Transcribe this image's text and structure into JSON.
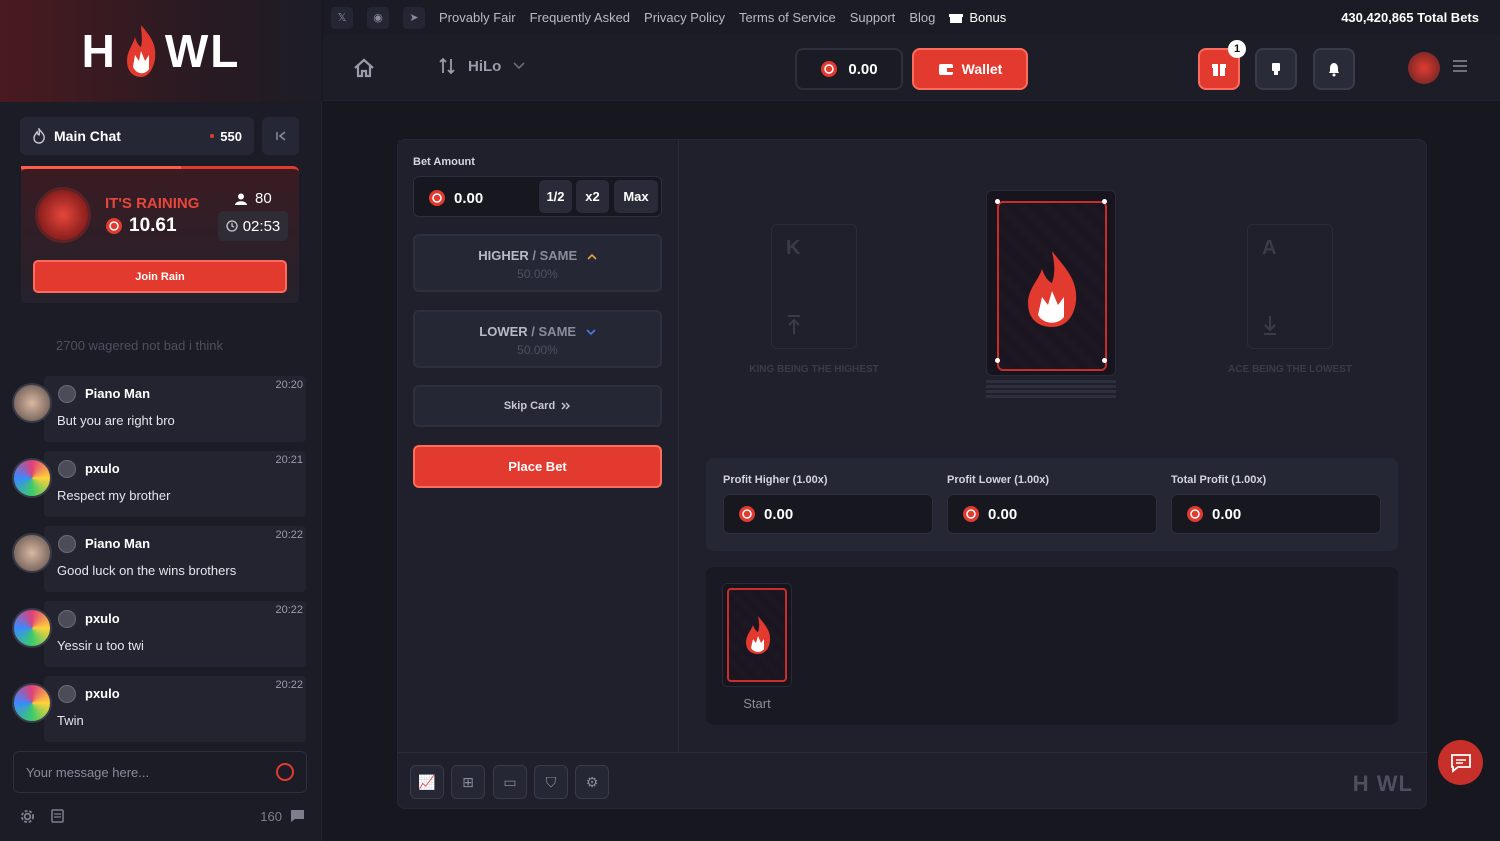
{
  "brand": {
    "logo_left": "H",
    "logo_right": "WL",
    "footer_logo": "H WL"
  },
  "top_nav": {
    "social": [
      "x-icon",
      "discord-icon",
      "telegram-icon"
    ],
    "links": [
      "Provably Fair",
      "Frequently Asked",
      "Privacy Policy",
      "Terms of Service",
      "Support",
      "Blog"
    ],
    "bonus_label": "Bonus",
    "total_bets": "430,420,865 Total Bets"
  },
  "header": {
    "game_name": "HiLo",
    "balance": "0.00",
    "wallet_label": "Wallet",
    "gift_badge": "1"
  },
  "chat": {
    "title": "Main Chat",
    "online": "550",
    "rain": {
      "title": "IT'S RAINING",
      "amount": "10.61",
      "users": "80",
      "timer": "02:53",
      "join_label": "Join Rain"
    },
    "faded_message": "2700 wagered not bad i think",
    "messages": [
      {
        "name": "Piano Man",
        "time": "20:20",
        "text": "But you are right bro"
      },
      {
        "name": "pxulo",
        "time": "20:21",
        "text": "Respect my brother"
      },
      {
        "name": "Piano Man",
        "time": "20:22",
        "text": "Good luck on the wins brothers"
      },
      {
        "name": "pxulo",
        "time": "20:22",
        "text": "Yessir u too twi"
      },
      {
        "name": "pxulo",
        "time": "20:22",
        "text": "Twin"
      }
    ],
    "input_placeholder": "Your message here...",
    "footer_count": "160"
  },
  "game": {
    "bet_label": "Bet Amount",
    "bet_value": "0.00",
    "half_label": "1/2",
    "double_label": "x2",
    "max_label": "Max",
    "higher": {
      "main": "HIGHER",
      "sep": " / SAME",
      "pct": "50.00%"
    },
    "lower": {
      "main": "LOWER",
      "sep": " / SAME",
      "pct": "50.00%"
    },
    "skip_label": "Skip Card",
    "place_label": "Place Bet",
    "king_letter": "K",
    "king_caption": "KING BEING THE HIGHEST",
    "ace_letter": "A",
    "ace_caption": "ACE BEING THE LOWEST",
    "profit_higher_label": "Profit Higher (1.00x)",
    "profit_higher_value": "0.00",
    "profit_lower_label": "Profit Lower (1.00x)",
    "profit_lower_value": "0.00",
    "total_profit_label": "Total Profit (1.00x)",
    "total_profit_value": "0.00",
    "history_label": "Start"
  },
  "colors": {
    "accent": "#e23a2f",
    "panel": "#1f202b",
    "bg": "#16171f"
  }
}
